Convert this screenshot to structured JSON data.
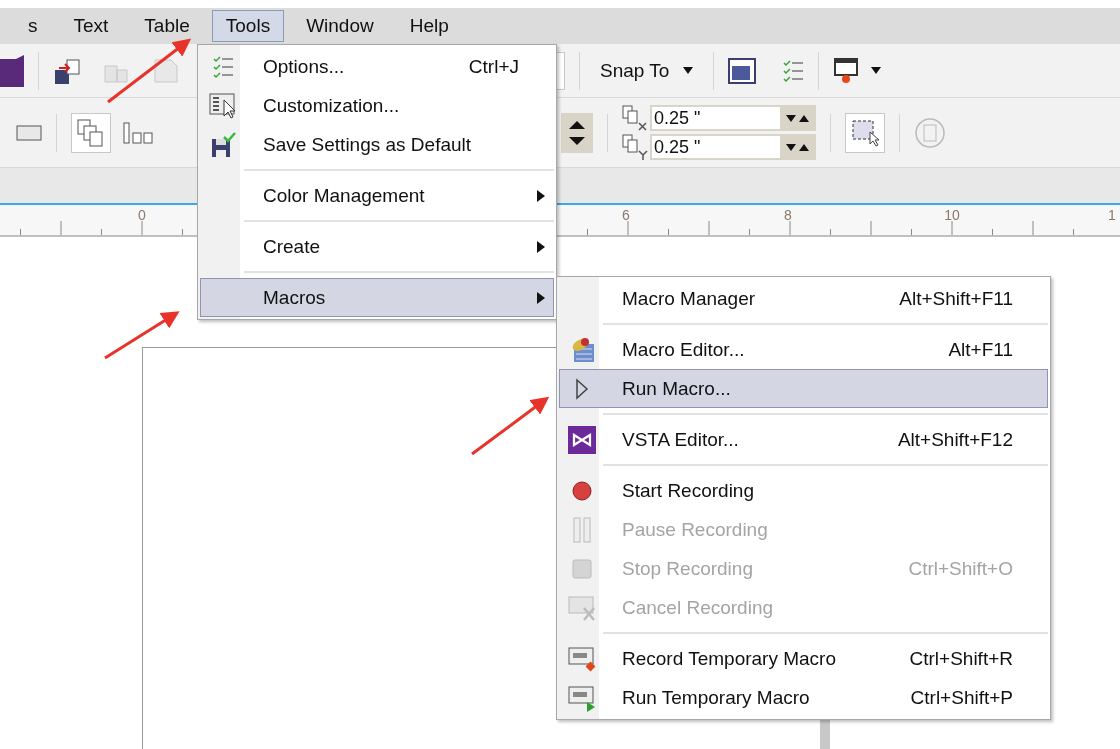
{
  "menubar": [
    {
      "label": "s",
      "selected": false
    },
    {
      "label": "Text",
      "selected": false
    },
    {
      "label": "Table",
      "selected": false
    },
    {
      "label": "Tools",
      "selected": true
    },
    {
      "label": "Window",
      "selected": false
    },
    {
      "label": "Help",
      "selected": false
    }
  ],
  "toolbar": {
    "snap_button": "Snap To",
    "duplicate_x": "0.25 \"",
    "duplicate_y": "0.25 \""
  },
  "ruler": {
    "labels": [
      "0",
      "6",
      "8",
      "10",
      "1"
    ]
  },
  "tools_menu": [
    {
      "kind": "item",
      "label": "Options...",
      "shortcut": "Ctrl+J",
      "has_submenu": false,
      "selected": false,
      "disabled": false
    },
    {
      "kind": "item",
      "label": "Customization...",
      "has_submenu": false,
      "selected": false,
      "disabled": false
    },
    {
      "kind": "item",
      "label": "Save Settings as Default",
      "has_submenu": false,
      "selected": false,
      "disabled": false
    },
    {
      "kind": "separator"
    },
    {
      "kind": "item",
      "label": "Color Management",
      "has_submenu": true,
      "selected": false,
      "disabled": false
    },
    {
      "kind": "separator"
    },
    {
      "kind": "item",
      "label": "Create",
      "has_submenu": true,
      "selected": false,
      "disabled": false
    },
    {
      "kind": "separator"
    },
    {
      "kind": "item",
      "label": "Macros",
      "has_submenu": true,
      "selected": true,
      "disabled": false
    }
  ],
  "macros_submenu": [
    {
      "kind": "item",
      "label": "Macro Manager",
      "shortcut": "Alt+Shift+F11",
      "selected": false,
      "disabled": false
    },
    {
      "kind": "separator"
    },
    {
      "kind": "item",
      "label": "Macro Editor...",
      "shortcut": "Alt+F11",
      "selected": false,
      "disabled": false
    },
    {
      "kind": "item",
      "label": "Run Macro...",
      "selected": true,
      "disabled": false
    },
    {
      "kind": "separator"
    },
    {
      "kind": "item",
      "label": "VSTA Editor...",
      "shortcut": "Alt+Shift+F12",
      "selected": false,
      "disabled": false
    },
    {
      "kind": "separator"
    },
    {
      "kind": "item",
      "label": "Start Recording",
      "selected": false,
      "disabled": false
    },
    {
      "kind": "item",
      "label": "Pause Recording",
      "selected": false,
      "disabled": true
    },
    {
      "kind": "item",
      "label": "Stop Recording",
      "shortcut": "Ctrl+Shift+O",
      "selected": false,
      "disabled": true
    },
    {
      "kind": "item",
      "label": "Cancel Recording",
      "selected": false,
      "disabled": true
    },
    {
      "kind": "separator"
    },
    {
      "kind": "item",
      "label": "Record Temporary Macro",
      "shortcut": "Ctrl+Shift+R",
      "selected": false,
      "disabled": false
    },
    {
      "kind": "item",
      "label": "Run Temporary Macro",
      "shortcut": "Ctrl+Shift+P",
      "selected": false,
      "disabled": false
    }
  ]
}
